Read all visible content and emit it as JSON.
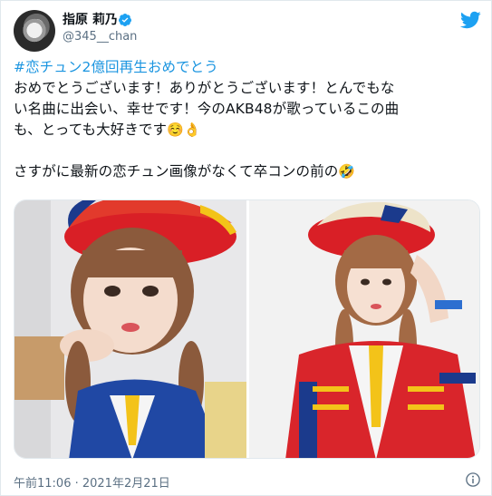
{
  "author": {
    "display_name": "指原 莉乃",
    "handle": "@345__chan"
  },
  "icons": {
    "avatar": "profile-photo",
    "verified": "verified-badge-icon",
    "brand": "twitter-bird-icon",
    "info": "info-icon"
  },
  "colors": {
    "link": "#1b95e0",
    "secondary_text": "#5b7083",
    "twitter_blue": "#1da1f2"
  },
  "tweet": {
    "hashtag": "#恋チュン2億回再生おめでとう",
    "line1": "おめでとうございます！ありがとうございます！とんでもな",
    "line2": "い名曲に出会い、幸せです！今のAKB48が歌っているこの曲",
    "line3": "も、とっても大好きです",
    "line3_emojis": "☺️👌",
    "line5": "さすがに最新の恋チュン画像がなくて卒コンの前の",
    "line5_emoji": "🤣"
  },
  "media": {
    "count": 2
  },
  "timestamp": "午前11:06 · 2021年2月21日"
}
